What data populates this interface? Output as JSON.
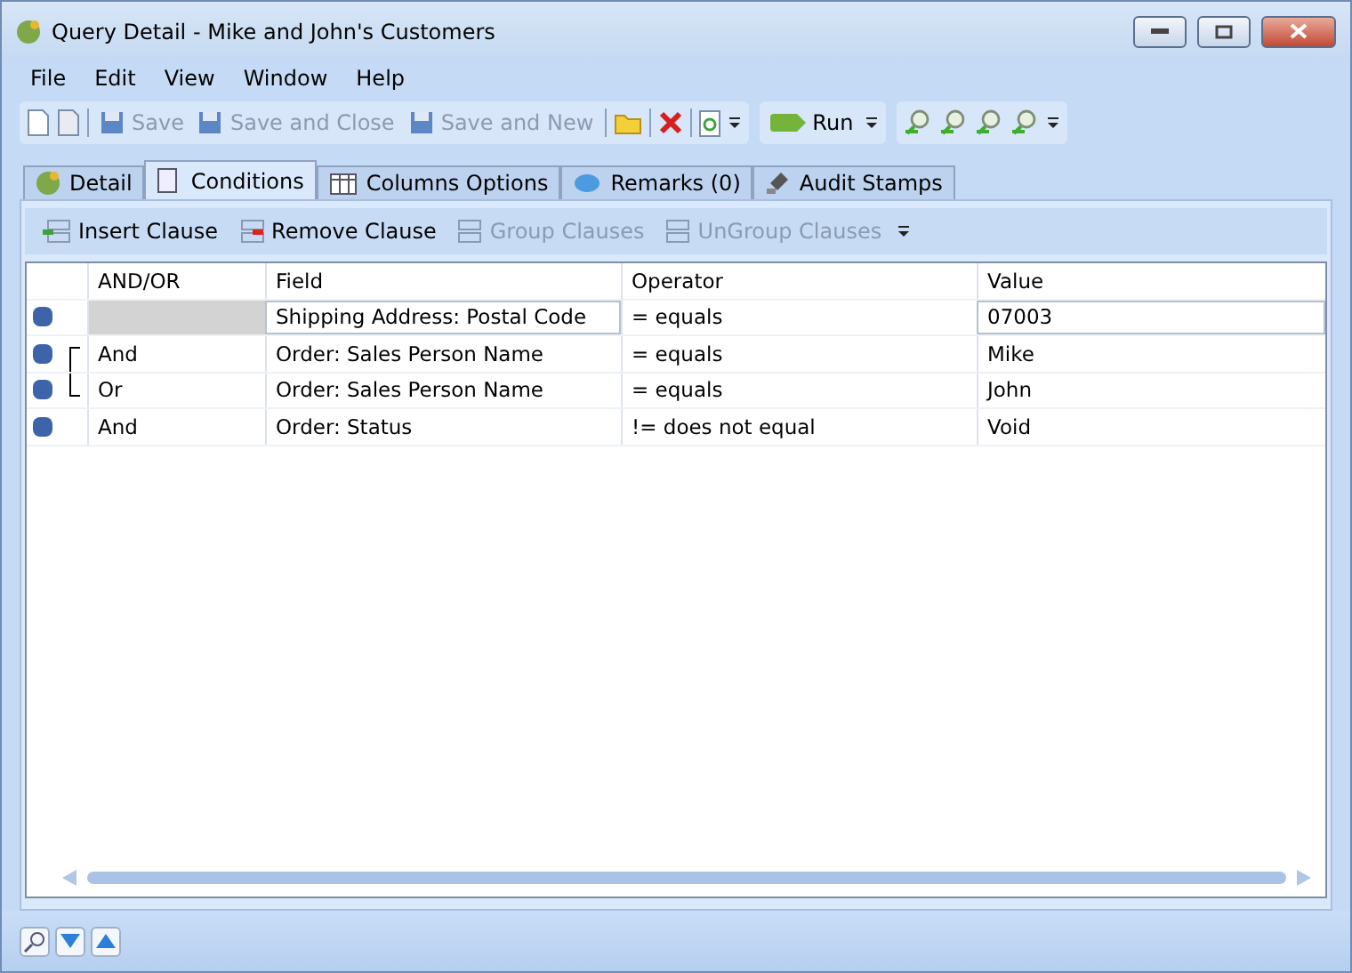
{
  "window": {
    "title": "Query Detail - Mike and John's Customers"
  },
  "menu": [
    "File",
    "Edit",
    "View",
    "Window",
    "Help"
  ],
  "toolbar": {
    "buttons": [
      {
        "label": "Save",
        "disabled": true
      },
      {
        "label": "Save and Close",
        "disabled": true
      },
      {
        "label": "Save and New",
        "disabled": true
      },
      {
        "label": "Run",
        "disabled": false
      }
    ]
  },
  "tabs": [
    {
      "label": "Detail",
      "selected": false
    },
    {
      "label": "Conditions",
      "selected": true
    },
    {
      "label": "Columns Options",
      "selected": false
    },
    {
      "label": "Remarks (0)",
      "selected": false
    },
    {
      "label": "Audit Stamps",
      "selected": false
    }
  ],
  "clause_toolbar": [
    {
      "label": "Insert Clause",
      "disabled": false
    },
    {
      "label": "Remove Clause",
      "disabled": false
    },
    {
      "label": "Group Clauses",
      "disabled": true
    },
    {
      "label": "UnGroup Clauses",
      "disabled": true
    }
  ],
  "grid": {
    "columns": [
      "AND/OR",
      "Field",
      "Operator",
      "Value"
    ],
    "rows": [
      {
        "and_or": "",
        "field": "Shipping Address: Postal Code",
        "operator": "= equals",
        "value": "07003",
        "selected": true,
        "group_start": false,
        "group_end": false
      },
      {
        "and_or": "And",
        "field": "Order: Sales Person Name",
        "operator": "= equals",
        "value": "Mike",
        "selected": false,
        "group_start": true,
        "group_end": false
      },
      {
        "and_or": "Or",
        "field": "Order: Sales Person Name",
        "operator": "= equals",
        "value": "John",
        "selected": false,
        "group_start": false,
        "group_end": true
      },
      {
        "and_or": "And",
        "field": "Order: Status",
        "operator": "!= does not equal",
        "value": "Void",
        "selected": false,
        "group_start": false,
        "group_end": false
      }
    ]
  }
}
